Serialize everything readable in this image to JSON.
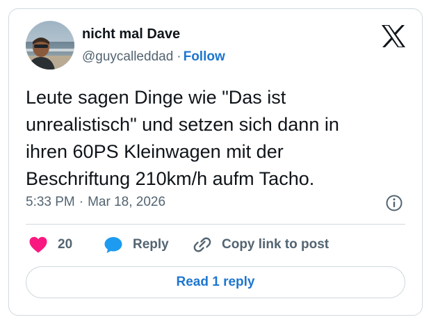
{
  "author": {
    "display_name": "nicht mal Dave",
    "handle": "@guycalleddad",
    "separator": "·",
    "follow_label": "Follow"
  },
  "tweet": {
    "lines": [
      "Leute sagen Dinge wie \"Das ist",
      "unrealistisch\" und setzen sich dann in",
      "ihren 60PS Kleinwagen mit der",
      "Beschriftung 210km/h aufm Tacho."
    ],
    "time": "5:33 PM",
    "separator": "·",
    "date": "Mar 18, 2026"
  },
  "actions": {
    "like_count": "20",
    "reply_label": "Reply",
    "copy_label": "Copy link to post"
  },
  "read_replies_label": "Read 1 reply",
  "icons": {
    "brand": "x-logo-icon",
    "info": "info-icon",
    "like": "heart-icon",
    "reply": "speech-bubble-icon",
    "copy": "link-icon"
  },
  "colors": {
    "accent": "#1d76cf",
    "like": "#f91880",
    "reply": "#1d9bf0",
    "secondary_text": "#536471",
    "border": "#cfd9de"
  }
}
